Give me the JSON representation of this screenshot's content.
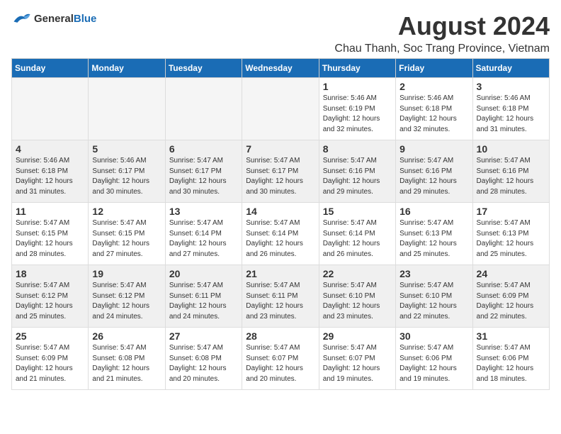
{
  "header": {
    "logo_general": "General",
    "logo_blue": "Blue",
    "title": "August 2024",
    "subtitle": "Chau Thanh, Soc Trang Province, Vietnam"
  },
  "days_of_week": [
    "Sunday",
    "Monday",
    "Tuesday",
    "Wednesday",
    "Thursday",
    "Friday",
    "Saturday"
  ],
  "weeks": [
    [
      {
        "day": "",
        "info": ""
      },
      {
        "day": "",
        "info": ""
      },
      {
        "day": "",
        "info": ""
      },
      {
        "day": "",
        "info": ""
      },
      {
        "day": "1",
        "info": "Sunrise: 5:46 AM\nSunset: 6:19 PM\nDaylight: 12 hours\nand 32 minutes."
      },
      {
        "day": "2",
        "info": "Sunrise: 5:46 AM\nSunset: 6:18 PM\nDaylight: 12 hours\nand 32 minutes."
      },
      {
        "day": "3",
        "info": "Sunrise: 5:46 AM\nSunset: 6:18 PM\nDaylight: 12 hours\nand 31 minutes."
      }
    ],
    [
      {
        "day": "4",
        "info": "Sunrise: 5:46 AM\nSunset: 6:18 PM\nDaylight: 12 hours\nand 31 minutes."
      },
      {
        "day": "5",
        "info": "Sunrise: 5:46 AM\nSunset: 6:17 PM\nDaylight: 12 hours\nand 30 minutes."
      },
      {
        "day": "6",
        "info": "Sunrise: 5:47 AM\nSunset: 6:17 PM\nDaylight: 12 hours\nand 30 minutes."
      },
      {
        "day": "7",
        "info": "Sunrise: 5:47 AM\nSunset: 6:17 PM\nDaylight: 12 hours\nand 30 minutes."
      },
      {
        "day": "8",
        "info": "Sunrise: 5:47 AM\nSunset: 6:16 PM\nDaylight: 12 hours\nand 29 minutes."
      },
      {
        "day": "9",
        "info": "Sunrise: 5:47 AM\nSunset: 6:16 PM\nDaylight: 12 hours\nand 29 minutes."
      },
      {
        "day": "10",
        "info": "Sunrise: 5:47 AM\nSunset: 6:16 PM\nDaylight: 12 hours\nand 28 minutes."
      }
    ],
    [
      {
        "day": "11",
        "info": "Sunrise: 5:47 AM\nSunset: 6:15 PM\nDaylight: 12 hours\nand 28 minutes."
      },
      {
        "day": "12",
        "info": "Sunrise: 5:47 AM\nSunset: 6:15 PM\nDaylight: 12 hours\nand 27 minutes."
      },
      {
        "day": "13",
        "info": "Sunrise: 5:47 AM\nSunset: 6:14 PM\nDaylight: 12 hours\nand 27 minutes."
      },
      {
        "day": "14",
        "info": "Sunrise: 5:47 AM\nSunset: 6:14 PM\nDaylight: 12 hours\nand 26 minutes."
      },
      {
        "day": "15",
        "info": "Sunrise: 5:47 AM\nSunset: 6:14 PM\nDaylight: 12 hours\nand 26 minutes."
      },
      {
        "day": "16",
        "info": "Sunrise: 5:47 AM\nSunset: 6:13 PM\nDaylight: 12 hours\nand 25 minutes."
      },
      {
        "day": "17",
        "info": "Sunrise: 5:47 AM\nSunset: 6:13 PM\nDaylight: 12 hours\nand 25 minutes."
      }
    ],
    [
      {
        "day": "18",
        "info": "Sunrise: 5:47 AM\nSunset: 6:12 PM\nDaylight: 12 hours\nand 25 minutes."
      },
      {
        "day": "19",
        "info": "Sunrise: 5:47 AM\nSunset: 6:12 PM\nDaylight: 12 hours\nand 24 minutes."
      },
      {
        "day": "20",
        "info": "Sunrise: 5:47 AM\nSunset: 6:11 PM\nDaylight: 12 hours\nand 24 minutes."
      },
      {
        "day": "21",
        "info": "Sunrise: 5:47 AM\nSunset: 6:11 PM\nDaylight: 12 hours\nand 23 minutes."
      },
      {
        "day": "22",
        "info": "Sunrise: 5:47 AM\nSunset: 6:10 PM\nDaylight: 12 hours\nand 23 minutes."
      },
      {
        "day": "23",
        "info": "Sunrise: 5:47 AM\nSunset: 6:10 PM\nDaylight: 12 hours\nand 22 minutes."
      },
      {
        "day": "24",
        "info": "Sunrise: 5:47 AM\nSunset: 6:09 PM\nDaylight: 12 hours\nand 22 minutes."
      }
    ],
    [
      {
        "day": "25",
        "info": "Sunrise: 5:47 AM\nSunset: 6:09 PM\nDaylight: 12 hours\nand 21 minutes."
      },
      {
        "day": "26",
        "info": "Sunrise: 5:47 AM\nSunset: 6:08 PM\nDaylight: 12 hours\nand 21 minutes."
      },
      {
        "day": "27",
        "info": "Sunrise: 5:47 AM\nSunset: 6:08 PM\nDaylight: 12 hours\nand 20 minutes."
      },
      {
        "day": "28",
        "info": "Sunrise: 5:47 AM\nSunset: 6:07 PM\nDaylight: 12 hours\nand 20 minutes."
      },
      {
        "day": "29",
        "info": "Sunrise: 5:47 AM\nSunset: 6:07 PM\nDaylight: 12 hours\nand 19 minutes."
      },
      {
        "day": "30",
        "info": "Sunrise: 5:47 AM\nSunset: 6:06 PM\nDaylight: 12 hours\nand 19 minutes."
      },
      {
        "day": "31",
        "info": "Sunrise: 5:47 AM\nSunset: 6:06 PM\nDaylight: 12 hours\nand 18 minutes."
      }
    ]
  ]
}
